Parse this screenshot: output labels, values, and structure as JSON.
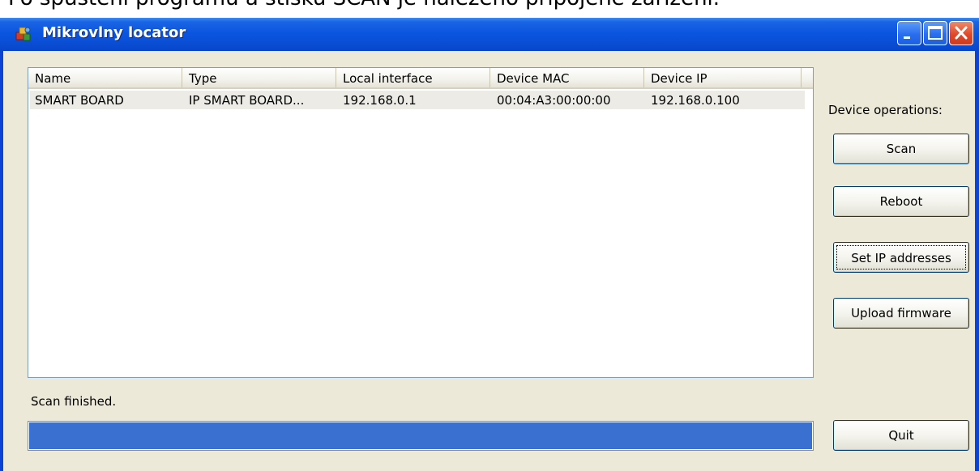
{
  "caption": {
    "text": "Po spuštění programu a stisku SCAN je nalezeno připojené zařízení."
  },
  "window": {
    "title": "Mikrovlny locator",
    "icon": "app-icon",
    "controls": [
      "minimize-icon",
      "maximize-icon",
      "close-icon"
    ]
  },
  "listview": {
    "columns": [
      "Name",
      "Type",
      "Local interface",
      "Device MAC",
      "Device IP"
    ],
    "rows": [
      {
        "name": "SMART BOARD",
        "type": "IP SMART BOARD...",
        "local_interface": "192.168.0.1",
        "device_mac": "00:04:A3:00:00:00",
        "device_ip": "192.168.0.100"
      }
    ]
  },
  "operations": {
    "label": "Device operations:",
    "scan": "Scan",
    "reboot": "Reboot",
    "set_ip": "Set IP addresses",
    "upload_firmware": "Upload firmware",
    "quit": "Quit"
  },
  "status": {
    "text": "Scan finished.",
    "progress": 1.0
  },
  "colors": {
    "titlebar": "#0b56df",
    "client": "#ece9d8",
    "progress": "#3a70d0"
  }
}
